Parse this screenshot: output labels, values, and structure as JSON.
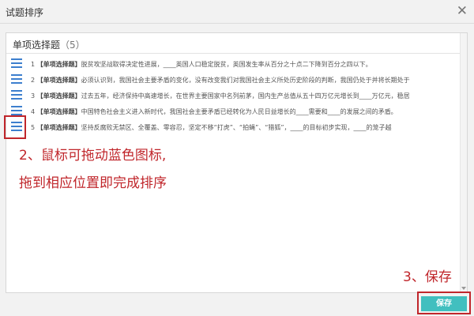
{
  "window": {
    "title": "试题排序",
    "close_icon": "close-icon"
  },
  "section": {
    "title": "单项选择题",
    "count": "（5）"
  },
  "questions": [
    {
      "num": "1",
      "tag": "【单项选择题】",
      "text": "脱贫攻坚战取得决定性进展，____英国人口稳定脱贫，英国发生率从百分之十点二下降到百分之四以下。"
    },
    {
      "num": "2",
      "tag": "【单项选择题】",
      "text": "必须认识到，我国社会主要矛盾的变化，没有改变我们对我国社会主义所处历史阶段的判断，我国仍处于并将长期处于"
    },
    {
      "num": "3",
      "tag": "【单项选择题】",
      "text": "过去五年，经济保持中高速增长，在世界主要国家中名列前茅，国内生产总值从五十四万亿元增长到____万亿元，稳居"
    },
    {
      "num": "4",
      "tag": "【单项选择题】",
      "text": "中国特色社会主义进入新时代，我国社会主要矛盾已经转化为人民日益增长的____需要和____的发展之间的矛盾。"
    },
    {
      "num": "5",
      "tag": "【单项选择题】",
      "text": "坚持反腐败无禁区、全覆盖、零容忍，坚定不移“打虎”、“拍蝇”、“猎狐”，____的目标初步实现，____的笼子越"
    }
  ],
  "annotations": {
    "step2_line1": "2、鼠标可拖动蓝色图标,",
    "step2_line2": "拖到相应位置即完成排序",
    "step3": "3、保存"
  },
  "buttons": {
    "save_label": "保存"
  },
  "colors": {
    "accent": "#41bfbf",
    "annotation_red": "#c0262b",
    "handle_blue": "#3d7fce"
  }
}
